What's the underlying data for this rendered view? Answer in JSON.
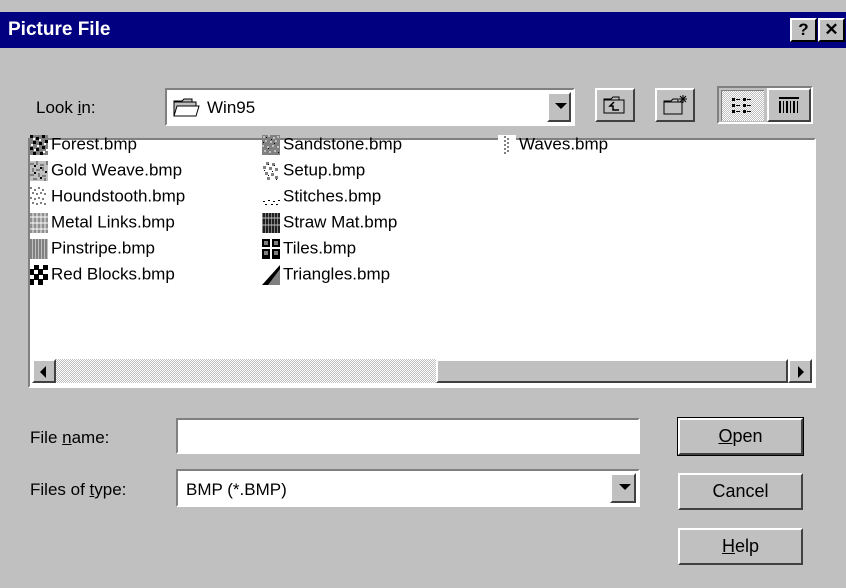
{
  "window": {
    "title": "Picture File",
    "help_button": "?",
    "close_button": "✕"
  },
  "look_in": {
    "label_pre": "Look ",
    "label_accel": "i",
    "label_post": "n:",
    "value": "Win95"
  },
  "files": [
    {
      "name": "Forest.bmp",
      "icon": "forest-bitmap-icon"
    },
    {
      "name": "Gold Weave.bmp",
      "icon": "gold-weave-bitmap-icon"
    },
    {
      "name": "Houndstooth.bmp",
      "icon": "houndstooth-bitmap-icon"
    },
    {
      "name": "Metal Links.bmp",
      "icon": "metal-links-bitmap-icon"
    },
    {
      "name": "Pinstripe.bmp",
      "icon": "pinstripe-bitmap-icon"
    },
    {
      "name": "Red Blocks.bmp",
      "icon": "red-blocks-bitmap-icon"
    },
    {
      "name": "Sandstone.bmp",
      "icon": "sandstone-bitmap-icon"
    },
    {
      "name": "Setup.bmp",
      "icon": "setup-bitmap-icon"
    },
    {
      "name": "Stitches.bmp",
      "icon": "stitches-bitmap-icon"
    },
    {
      "name": "Straw Mat.bmp",
      "icon": "straw-mat-bitmap-icon"
    },
    {
      "name": "Tiles.bmp",
      "icon": "tiles-bitmap-icon"
    },
    {
      "name": "Triangles.bmp",
      "icon": "triangles-bitmap-icon"
    },
    {
      "name": "Waves.bmp",
      "icon": "waves-bitmap-icon"
    }
  ],
  "file_name": {
    "label_pre": "File ",
    "label_accel": "n",
    "label_post": "ame:",
    "value": ""
  },
  "files_of_type": {
    "label_pre": "Files of ",
    "label_accel": "t",
    "label_post": "ype:",
    "value": "BMP (*.BMP)"
  },
  "buttons": {
    "open_accel": "O",
    "open_rest": "pen",
    "cancel": "Cancel",
    "help_accel": "H",
    "help_rest": "elp"
  },
  "colors": {
    "titlebar": "#000080",
    "face": "#c0c0c0"
  }
}
